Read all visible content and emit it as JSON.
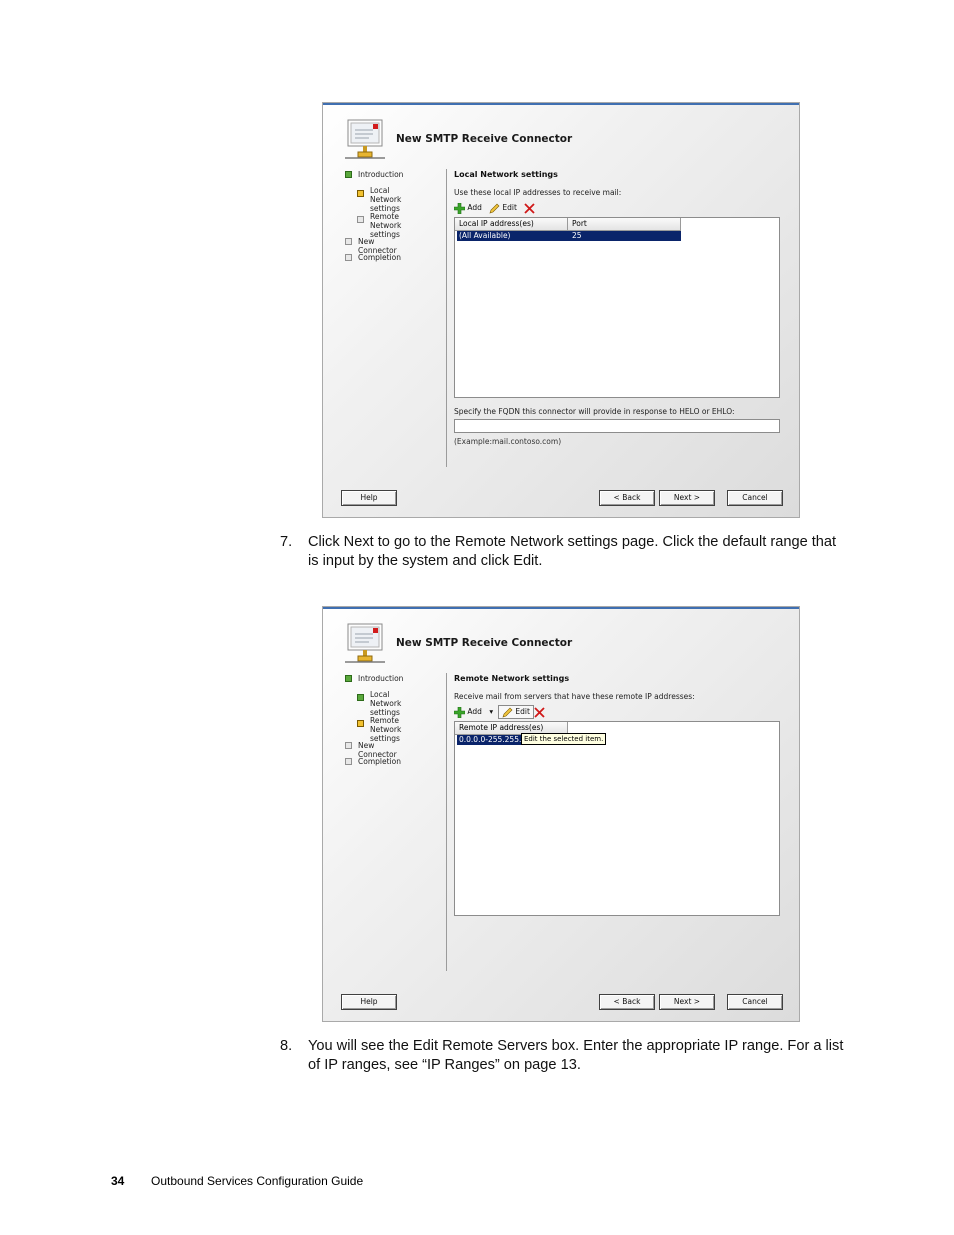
{
  "screenshot1": {
    "title": "New SMTP Receive Connector",
    "steps": [
      {
        "label": "Introduction",
        "state": "complete"
      },
      {
        "label": "Local Network\nsettings",
        "state": "current"
      },
      {
        "label": "Remote Network\nsettings",
        "state": "pending"
      },
      {
        "label": "New Connector",
        "state": "pending"
      },
      {
        "label": "Completion",
        "state": "pending"
      }
    ],
    "section_title": "Local Network settings",
    "section_desc": "Use these local IP addresses to receive mail:",
    "toolbar": {
      "add": "Add",
      "edit": "Edit"
    },
    "grid": {
      "headers": [
        "Local IP address(es)",
        "Port"
      ],
      "rows": [
        [
          "(All Available)",
          "25"
        ]
      ]
    },
    "fqdn_label": "Specify the FQDN this connector will provide in response to HELO or EHLO:",
    "fqdn_value": "",
    "example": "(Example:mail.contoso.com)",
    "buttons": {
      "help": "Help",
      "back": "< Back",
      "next": "Next >",
      "cancel": "Cancel"
    }
  },
  "step7": {
    "number": "7.",
    "text": "Click Next to go to the Remote Network settings page. Click the default range that is input by the system and click Edit."
  },
  "screenshot2": {
    "title": "New SMTP Receive Connector",
    "steps": [
      {
        "label": "Introduction",
        "state": "complete"
      },
      {
        "label": "Local Network\nsettings",
        "state": "complete"
      },
      {
        "label": "Remote Network\nsettings",
        "state": "current"
      },
      {
        "label": "New Connector",
        "state": "pending"
      },
      {
        "label": "Completion",
        "state": "pending"
      }
    ],
    "section_title": "Remote Network settings",
    "section_desc": "Receive mail from servers that have these remote IP addresses:",
    "toolbar": {
      "add": "Add",
      "edit": "Edit"
    },
    "grid": {
      "headers": [
        "Remote IP address(es)"
      ],
      "rows": [
        [
          "0.0.0.0-255.255.255.255"
        ]
      ]
    },
    "tooltip": "Edit the selected item.",
    "buttons": {
      "help": "Help",
      "back": "< Back",
      "next": "Next >",
      "cancel": "Cancel"
    }
  },
  "step8": {
    "number": "8.",
    "text": "You will see the Edit Remote Servers box. Enter the appropriate IP range. For a list of IP ranges, see “IP Ranges” on page 13."
  },
  "footer": {
    "page_number": "34",
    "doc_title": "Outbound Services Configuration Guide"
  }
}
